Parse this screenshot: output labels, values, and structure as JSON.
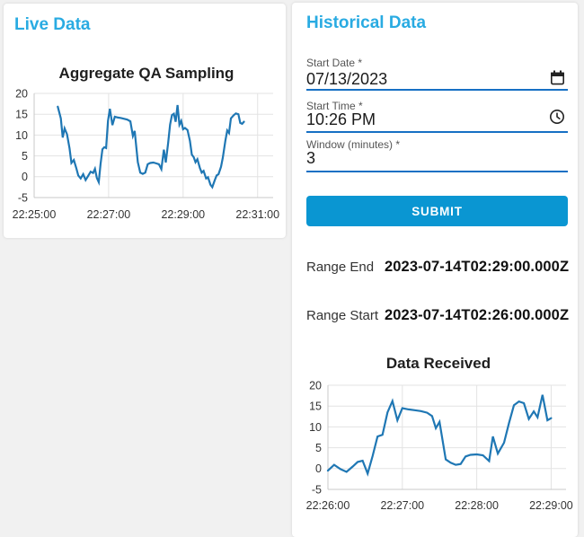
{
  "page": {
    "background": "#f1f1f1",
    "accent": "#29abe2"
  },
  "live_panel": {
    "heading": "Live Data"
  },
  "historical_panel": {
    "heading": "Historical Data",
    "fields": [
      {
        "label": "Start Date *",
        "value": "07/13/2023",
        "icon": "calendar-icon"
      },
      {
        "label": "Start Time *",
        "value": "10:26 PM",
        "icon": "clock-icon"
      },
      {
        "label": "Window (minutes) *",
        "value": "3",
        "icon": null
      }
    ],
    "submit_label": "SUBMIT",
    "results": [
      {
        "label": "Range End",
        "value": "2023-07-14T02:29:00.000Z"
      },
      {
        "label": "Range Start",
        "value": "2023-07-14T02:26:00.000Z"
      }
    ],
    "colors": {
      "underline": "#1670c4",
      "submit_bg": "#0a96d2",
      "submit_text": "#ffffff"
    }
  },
  "chart_data": [
    {
      "type": "line",
      "title": "Aggregate QA Sampling",
      "x_unit": "seconds after 22:25:00",
      "points": [
        [
          38,
          16.8
        ],
        [
          43,
          14.0
        ],
        [
          46,
          9.4
        ],
        [
          49,
          11.6
        ],
        [
          53,
          10.2
        ],
        [
          57,
          6.8
        ],
        [
          60,
          3.3
        ],
        [
          64,
          4.0
        ],
        [
          68,
          2.0
        ],
        [
          71,
          0.3
        ],
        [
          75,
          -0.4
        ],
        [
          79,
          0.6
        ],
        [
          83,
          -0.8
        ],
        [
          87,
          0.2
        ],
        [
          91,
          1.2
        ],
        [
          95,
          0.9
        ],
        [
          98,
          1.9
        ],
        [
          101,
          -0.3
        ],
        [
          104,
          -1.3
        ],
        [
          107,
          3.0
        ],
        [
          110,
          6.6
        ],
        [
          113,
          7.1
        ],
        [
          116,
          6.9
        ],
        [
          119,
          13.4
        ],
        [
          122,
          16.3
        ],
        [
          126,
          12.4
        ],
        [
          130,
          14.4
        ],
        [
          135,
          14.2
        ],
        [
          140,
          14.1
        ],
        [
          145,
          13.9
        ],
        [
          150,
          13.7
        ],
        [
          155,
          13.3
        ],
        [
          159,
          9.8
        ],
        [
          162,
          11.0
        ],
        [
          167,
          3.5
        ],
        [
          171,
          1.0
        ],
        [
          175,
          0.7
        ],
        [
          179,
          1.0
        ],
        [
          183,
          3.0
        ],
        [
          187,
          3.3
        ],
        [
          192,
          3.4
        ],
        [
          197,
          3.2
        ],
        [
          201,
          3.0
        ],
        [
          205,
          1.8
        ],
        [
          209,
          6.5
        ],
        [
          212,
          3.4
        ],
        [
          216,
          8.2
        ],
        [
          219,
          12.5
        ],
        [
          222,
          14.8
        ],
        [
          225,
          15.1
        ],
        [
          228,
          13.2
        ],
        [
          231,
          17.2
        ],
        [
          234,
          12.5
        ],
        [
          237,
          13.4
        ],
        [
          240,
          11.4
        ],
        [
          243,
          11.7
        ],
        [
          247,
          11.2
        ],
        [
          251,
          8.6
        ],
        [
          254,
          5.3
        ],
        [
          257,
          4.7
        ],
        [
          260,
          3.5
        ],
        [
          263,
          4.2
        ],
        [
          267,
          2.1
        ],
        [
          270,
          1.0
        ],
        [
          273,
          1.4
        ],
        [
          277,
          -0.4
        ],
        [
          280,
          -0.1
        ],
        [
          284,
          -1.9
        ],
        [
          287,
          -2.5
        ],
        [
          291,
          -0.8
        ],
        [
          294,
          0.3
        ],
        [
          297,
          0.6
        ],
        [
          301,
          2.4
        ],
        [
          304,
          4.6
        ],
        [
          308,
          8.6
        ],
        [
          311,
          11.1
        ],
        [
          314,
          10.5
        ],
        [
          317,
          14.0
        ],
        [
          321,
          14.7
        ],
        [
          325,
          15.2
        ],
        [
          329,
          15.0
        ],
        [
          332,
          12.9
        ],
        [
          335,
          12.7
        ],
        [
          338,
          13.2
        ]
      ],
      "x_domain_seconds": [
        0,
        385
      ],
      "x_tick_seconds": [
        0,
        120,
        240,
        360
      ],
      "x_tick_labels": [
        "22:25:00",
        "22:27:00",
        "22:29:00",
        "22:31:00"
      ],
      "y_ticks": [
        20,
        15,
        10,
        5,
        0,
        -5
      ],
      "ylim": [
        -5,
        20
      ],
      "line_color": "#1f77b4",
      "grid": true,
      "legend": false
    },
    {
      "type": "line",
      "title": "Data Received",
      "x_unit": "seconds after 22:25:00",
      "points": [
        [
          60,
          -0.5
        ],
        [
          65,
          0.9
        ],
        [
          70,
          -0.1
        ],
        [
          75,
          -0.8
        ],
        [
          80,
          0.5
        ],
        [
          84,
          1.6
        ],
        [
          88,
          1.9
        ],
        [
          92,
          -1.2
        ],
        [
          96,
          3.0
        ],
        [
          100,
          7.7
        ],
        [
          104,
          8.1
        ],
        [
          108,
          13.5
        ],
        [
          112,
          16.2
        ],
        [
          116,
          11.6
        ],
        [
          120,
          14.5
        ],
        [
          125,
          14.2
        ],
        [
          130,
          14.0
        ],
        [
          135,
          13.8
        ],
        [
          140,
          13.4
        ],
        [
          144,
          12.6
        ],
        [
          147,
          9.7
        ],
        [
          150,
          11.2
        ],
        [
          155,
          2.2
        ],
        [
          159,
          1.4
        ],
        [
          163,
          0.9
        ],
        [
          167,
          1.1
        ],
        [
          171,
          2.9
        ],
        [
          175,
          3.3
        ],
        [
          180,
          3.4
        ],
        [
          185,
          3.2
        ],
        [
          190,
          1.8
        ],
        [
          193,
          7.7
        ],
        [
          197,
          3.6
        ],
        [
          202,
          6.2
        ],
        [
          206,
          10.9
        ],
        [
          210,
          15.2
        ],
        [
          214,
          16.1
        ],
        [
          218,
          15.7
        ],
        [
          222,
          11.9
        ],
        [
          226,
          13.7
        ],
        [
          229,
          12.3
        ],
        [
          233,
          17.7
        ],
        [
          237,
          11.6
        ],
        [
          240,
          12.1
        ]
      ],
      "x_domain_seconds": [
        60,
        252
      ],
      "x_tick_seconds": [
        60,
        120,
        180,
        240
      ],
      "x_tick_labels": [
        "22:26:00",
        "22:27:00",
        "22:28:00",
        "22:29:00"
      ],
      "y_ticks": [
        20,
        15,
        10,
        5,
        0,
        -5
      ],
      "ylim": [
        -5,
        20
      ],
      "line_color": "#1f77b4",
      "grid": true,
      "legend": false
    }
  ]
}
